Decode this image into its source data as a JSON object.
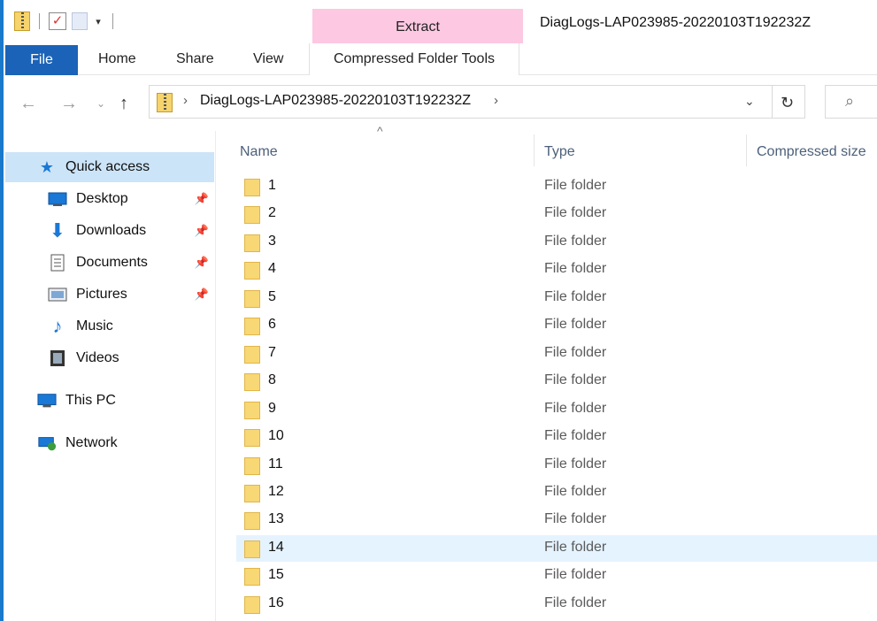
{
  "window": {
    "title": "DiagLogs-LAP023985-20220103T192232Z",
    "context_tab_header": "Extract"
  },
  "ribbon": {
    "tabs": [
      "File",
      "Home",
      "Share",
      "View",
      "Compressed Folder Tools"
    ]
  },
  "address": {
    "path": "DiagLogs-LAP023985-20220103T192232Z"
  },
  "icons": {
    "back": "arrow-left-icon",
    "forward": "arrow-right-icon",
    "recent": "chevron-down-icon",
    "up": "arrow-up-icon",
    "refresh": "refresh-icon",
    "search": "search-icon"
  },
  "nav": {
    "items": [
      {
        "label": "Quick access",
        "icon": "star-icon",
        "pinned": false
      },
      {
        "label": "Desktop",
        "icon": "desktop-icon",
        "pinned": true
      },
      {
        "label": "Downloads",
        "icon": "download-icon",
        "pinned": true
      },
      {
        "label": "Documents",
        "icon": "document-icon",
        "pinned": true
      },
      {
        "label": "Pictures",
        "icon": "pictures-icon",
        "pinned": true
      },
      {
        "label": "Music",
        "icon": "music-icon",
        "pinned": false
      },
      {
        "label": "Videos",
        "icon": "videos-icon",
        "pinned": false
      },
      {
        "label": "This PC",
        "icon": "computer-icon",
        "pinned": false
      },
      {
        "label": "Network",
        "icon": "network-icon",
        "pinned": false
      }
    ]
  },
  "columns": {
    "name": "Name",
    "type": "Type",
    "compressed_size": "Compressed size"
  },
  "files": [
    {
      "name": "1",
      "type": "File folder"
    },
    {
      "name": "2",
      "type": "File folder"
    },
    {
      "name": "3",
      "type": "File folder"
    },
    {
      "name": "4",
      "type": "File folder"
    },
    {
      "name": "5",
      "type": "File folder"
    },
    {
      "name": "6",
      "type": "File folder"
    },
    {
      "name": "7",
      "type": "File folder"
    },
    {
      "name": "8",
      "type": "File folder"
    },
    {
      "name": "9",
      "type": "File folder"
    },
    {
      "name": "10",
      "type": "File folder"
    },
    {
      "name": "11",
      "type": "File folder"
    },
    {
      "name": "12",
      "type": "File folder"
    },
    {
      "name": "13",
      "type": "File folder"
    },
    {
      "name": "14",
      "type": "File folder"
    },
    {
      "name": "15",
      "type": "File folder"
    },
    {
      "name": "16",
      "type": "File folder"
    }
  ],
  "selected_file_index": 13,
  "colors": {
    "accent": "#1a63b8",
    "context_tab": "#fcc8e2",
    "selection": "#cce4f7",
    "hover_row": "#e5f3ff",
    "folder": "#f8d775"
  }
}
